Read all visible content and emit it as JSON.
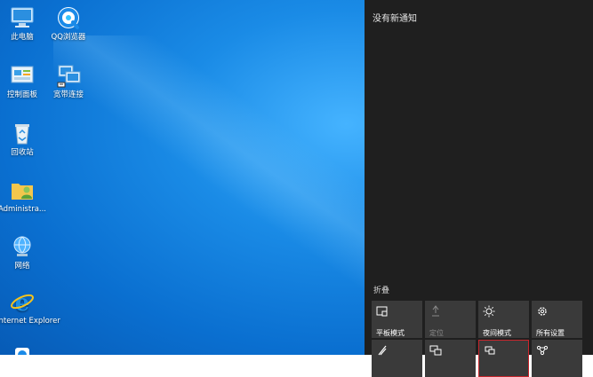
{
  "desktop": {
    "icons": [
      {
        "label": "此电脑",
        "icon": "computer-icon"
      },
      {
        "label": "QQ浏览器",
        "icon": "qq-browser-icon"
      },
      {
        "label": "控制面板",
        "icon": "control-panel-icon"
      },
      {
        "label": "宽带连接",
        "icon": "broadband-connection-icon"
      },
      {
        "label": "回收站",
        "icon": "recycle-bin-icon"
      },
      {
        "label": "Administra...",
        "icon": "user-folder-icon"
      },
      {
        "label": "网络",
        "icon": "network-icon"
      },
      {
        "label": "Internet Explorer",
        "icon": "internet-explorer-icon"
      }
    ]
  },
  "action_center": {
    "title": "没有新通知",
    "collapse_label": "折叠",
    "quick_actions": [
      {
        "label": "平板模式",
        "icon": "tablet-mode-icon",
        "enabled": true
      },
      {
        "label": "定位",
        "icon": "location-icon",
        "enabled": false
      },
      {
        "label": "夜间模式",
        "icon": "night-light-icon",
        "enabled": true
      },
      {
        "label": "所有设置",
        "icon": "settings-gear-icon",
        "enabled": true
      },
      {
        "label": "",
        "icon": "network-tile-icon",
        "enabled": true
      },
      {
        "label": "",
        "icon": "connect-tile-icon",
        "enabled": true
      },
      {
        "label": "",
        "icon": "project-tile-icon",
        "enabled": true,
        "selected": true
      },
      {
        "label": "",
        "icon": "vpn-tile-icon",
        "enabled": true
      }
    ]
  },
  "colors": {
    "desktop_blue": "#0a6fd0",
    "panel_bg": "#1f1f1f",
    "tile_bg": "#3a3a3a",
    "selected_border": "#c8262c"
  }
}
